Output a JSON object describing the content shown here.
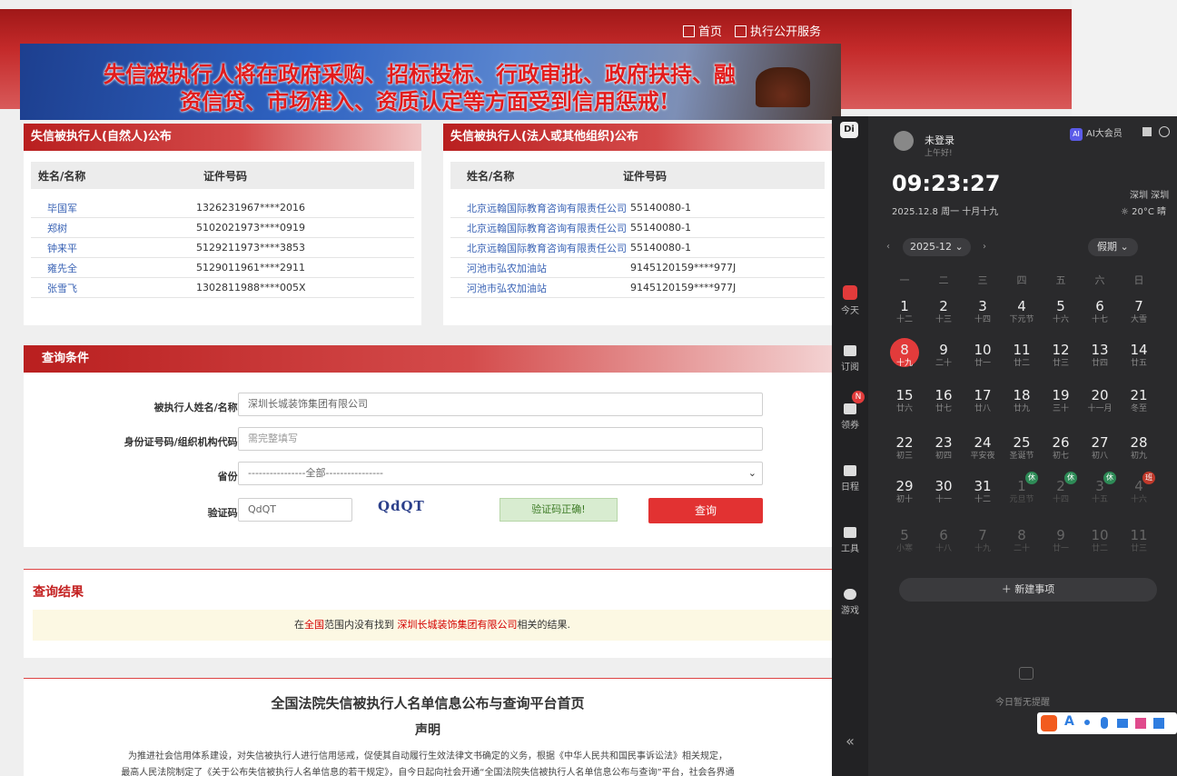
{
  "nav": {
    "home": "首页",
    "service": "执行公开服务"
  },
  "banner": {
    "line1": "失信被执行人将在政府采购、招标投标、行政审批、政府扶持、融",
    "line2": "资信贷、市场准入、资质认定等方面受到信用惩戒!"
  },
  "person_panel": {
    "title": "失信被执行人(自然人)公布",
    "col_name": "姓名/名称",
    "col_id": "证件号码",
    "rows": [
      {
        "name": "毕国军",
        "id": "1326231967****2016"
      },
      {
        "name": "郑树",
        "id": "5102021973****0919"
      },
      {
        "name": "钟来平",
        "id": "5129211973****3853"
      },
      {
        "name": "雍先全",
        "id": "5129011961****2911"
      },
      {
        "name": "张雪飞",
        "id": "1302811988****005X"
      }
    ]
  },
  "org_panel": {
    "title": "失信被执行人(法人或其他组织)公布",
    "col_name": "姓名/名称",
    "col_id": "证件号码",
    "rows": [
      {
        "name": "北京远翰国际教育咨询有限责任公司",
        "id": "55140080-1"
      },
      {
        "name": "北京远翰国际教育咨询有限责任公司",
        "id": "55140080-1"
      },
      {
        "name": "北京远翰国际教育咨询有限责任公司",
        "id": "55140080-1"
      },
      {
        "name": "河池市弘农加油站",
        "id": "9145120159****977J"
      },
      {
        "name": "河池市弘农加油站",
        "id": "9145120159****977J"
      }
    ]
  },
  "query": {
    "title": "查询条件",
    "name_label": "被执行人姓名/名称:",
    "name_value": "深圳长城装饰集团有限公司",
    "id_label": "身份证号码/组织机构代码:",
    "id_placeholder": "需完整填写",
    "prov_label": "省份:",
    "prov_value": "----------------全部----------------",
    "captcha_label": "验证码:",
    "captcha_value": "QdQT",
    "captcha_image": "QdQT",
    "captcha_ok": "验证码正确!",
    "submit": "查询"
  },
  "result": {
    "title": "查询结果",
    "pre": "在",
    "scope": "全国",
    "mid": "范围内没有找到 ",
    "company": "深圳长城装饰集团有限公司",
    "post": "相关的结果."
  },
  "bottom": {
    "title": "全国法院失信被执行人名单信息公布与查询平台首页",
    "subtitle": "声明",
    "p1": "为推进社会信用体系建设，对失信被执行人进行信用惩戒，促使其自动履行生效法律文书确定的义务，根据《中华人民共和国民事诉讼法》相关规定，",
    "p2": "最高人民法院制定了《关于公布失信被执行人名单信息的若干规定》，自今日起向社会开通“全国法院失信被执行人名单信息公布与查询”平台，社会各界通"
  },
  "widget": {
    "login": "未登录",
    "greet": "上午好!",
    "vip": "AI大会员",
    "time": "09:23:27",
    "date": "2025.12.8 周一 十月十九",
    "city": "深圳 深圳",
    "weather": "20°C 晴",
    "month_sel": "2025-12",
    "holiday_sel": "假期",
    "daynames": [
      "一",
      "二",
      "三",
      "四",
      "五",
      "六",
      "日"
    ],
    "rail": {
      "today": "今天",
      "sub": "订阅",
      "coupon": "领券",
      "schedule": "日程",
      "tools": "工具",
      "games": "游戏",
      "coupon_badge": "N"
    },
    "weeks": [
      [
        [
          "1",
          "十二"
        ],
        [
          "2",
          "十三"
        ],
        [
          "3",
          "十四"
        ],
        [
          "4",
          "下元节"
        ],
        [
          "5",
          "十六"
        ],
        [
          "6",
          "十七"
        ],
        [
          "7",
          "大雪"
        ]
      ],
      [
        [
          "8",
          "十九"
        ],
        [
          "9",
          "二十"
        ],
        [
          "10",
          "廿一"
        ],
        [
          "11",
          "廿二"
        ],
        [
          "12",
          "廿三"
        ],
        [
          "13",
          "廿四"
        ],
        [
          "14",
          "廿五"
        ]
      ],
      [
        [
          "15",
          "廿六"
        ],
        [
          "16",
          "廿七"
        ],
        [
          "17",
          "廿八"
        ],
        [
          "18",
          "廿九"
        ],
        [
          "19",
          "三十"
        ],
        [
          "20",
          "十一月"
        ],
        [
          "21",
          "冬至"
        ]
      ],
      [
        [
          "22",
          "初三"
        ],
        [
          "23",
          "初四"
        ],
        [
          "24",
          "平安夜"
        ],
        [
          "25",
          "圣诞节"
        ],
        [
          "26",
          "初七"
        ],
        [
          "27",
          "初八"
        ],
        [
          "28",
          "初九"
        ]
      ],
      [
        [
          "29",
          "初十"
        ],
        [
          "30",
          "十一"
        ],
        [
          "31",
          "十二"
        ],
        [
          "1",
          "元旦节"
        ],
        [
          "2",
          "十四"
        ],
        [
          "3",
          "十五"
        ],
        [
          "4",
          "十六"
        ]
      ],
      [
        [
          "5",
          "小寒"
        ],
        [
          "6",
          "十八"
        ],
        [
          "7",
          "十九"
        ],
        [
          "8",
          "二十"
        ],
        [
          "9",
          "廿一"
        ],
        [
          "10",
          "廿二"
        ],
        [
          "11",
          "廿三"
        ]
      ]
    ],
    "badges": {
      "rest": "休",
      "work": "班"
    },
    "new_event": "新建事项",
    "no_reminder": "今日暂无提醒",
    "collapse": "«",
    "ime_a": "A"
  },
  "colors": {
    "red": "#d43030",
    "dark": "#2a2a2c",
    "today": "#e23b3b"
  }
}
